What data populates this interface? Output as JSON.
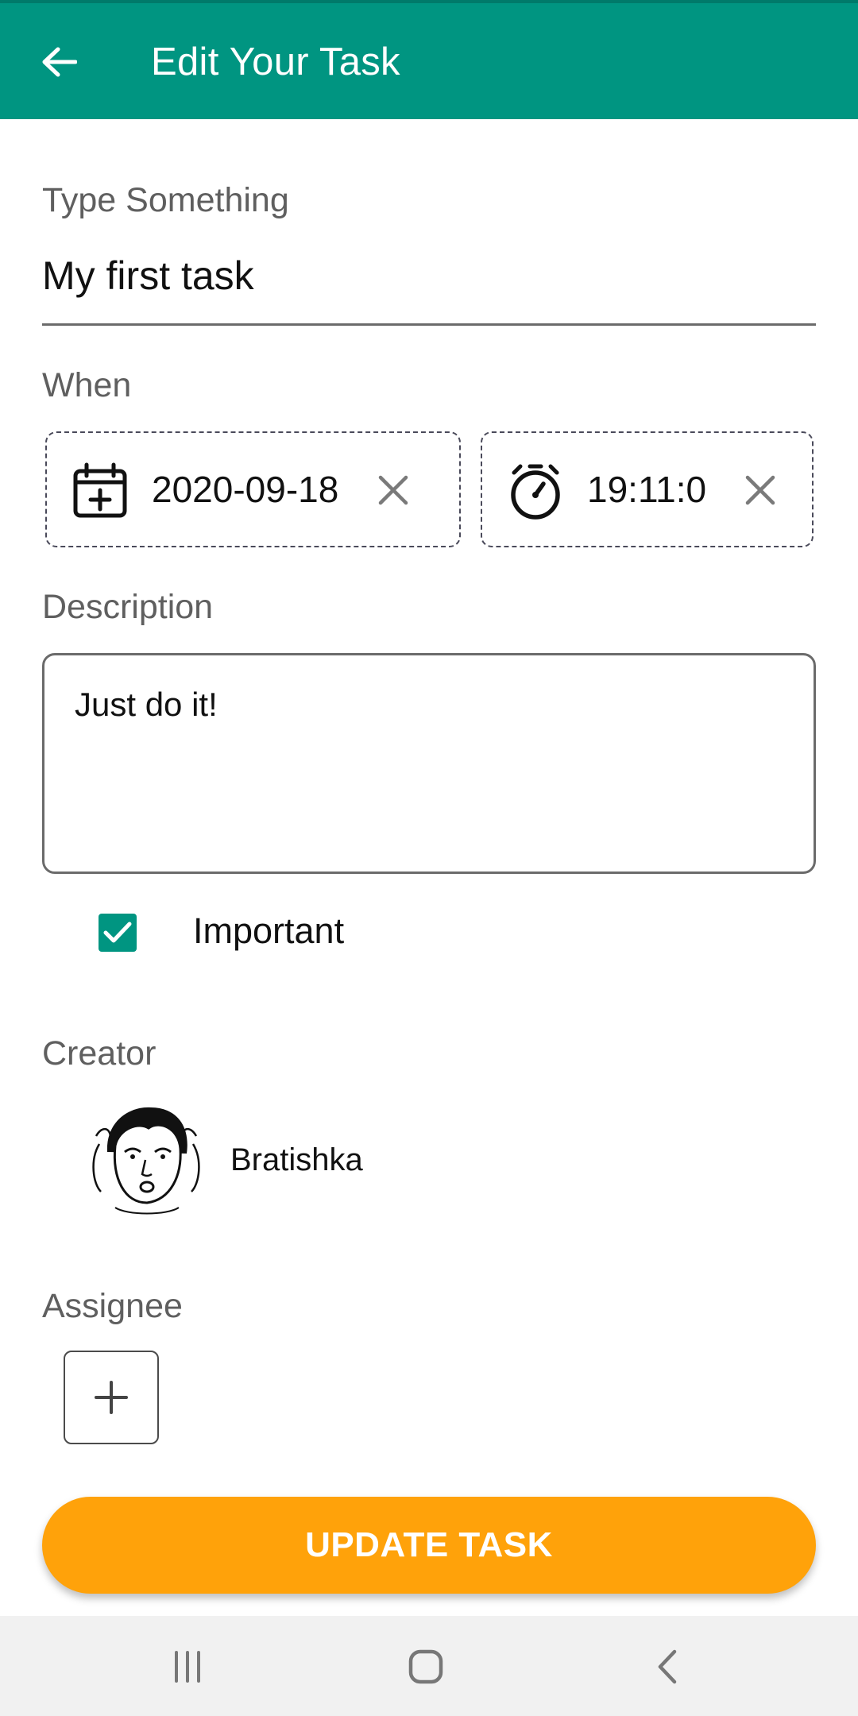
{
  "appbar": {
    "title": "Edit Your Task",
    "color": "#009581"
  },
  "task": {
    "label": "Type Something",
    "value": "My first task"
  },
  "when": {
    "label": "When",
    "date": "2020-09-18",
    "time": "19:11:0"
  },
  "description": {
    "label": "Description",
    "value": "Just do it!"
  },
  "important": {
    "label": "Important",
    "checked": true
  },
  "creator": {
    "label": "Creator",
    "name": "Bratishka"
  },
  "assignee": {
    "label": "Assignee"
  },
  "update_button": {
    "label": "UPDATE TASK",
    "color": "#ffa20a"
  },
  "icons": {
    "back": "arrow-left-icon",
    "date": "calendar-plus-icon",
    "time": "timer-icon",
    "clear": "close-icon",
    "add": "plus-icon",
    "nav_recents": "recents-icon",
    "nav_home": "home-icon",
    "nav_back": "chevron-left-icon"
  }
}
